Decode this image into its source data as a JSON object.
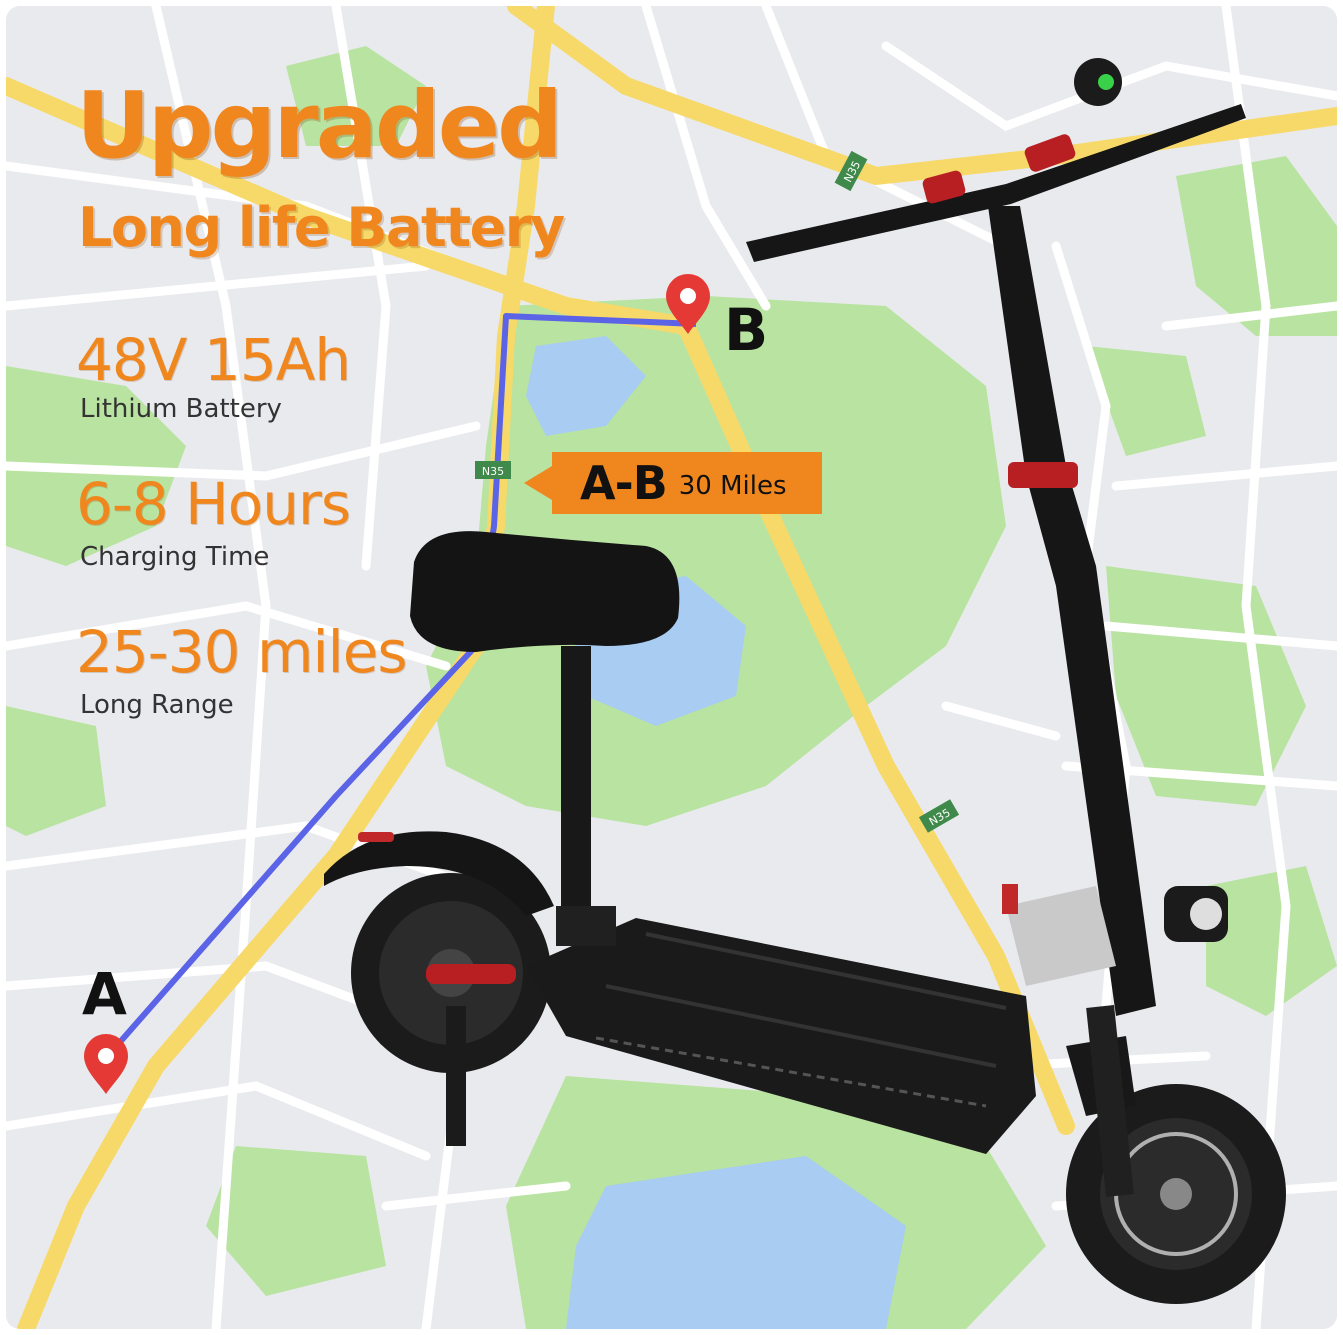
{
  "headline": "Upgraded",
  "subheadline": "Long life Battery",
  "specs": [
    {
      "value": "48V 15Ah",
      "label": "Lithium Battery"
    },
    {
      "value": "6-8 Hours",
      "label": "Charging Time"
    },
    {
      "value": "25-30 miles",
      "label": "Long Range"
    }
  ],
  "route": {
    "start_label": "A",
    "end_label": "B",
    "callout_route": "A-B",
    "callout_distance": "30 Miles"
  },
  "road_signs": [
    "N35",
    "N35",
    "N35"
  ],
  "colors": {
    "accent": "#f0871e",
    "map_background": "#e9eaee",
    "park": "#b9e3a0",
    "water": "#a8ccf2",
    "major_road": "#f7d96a",
    "route_line": "#5b63e6",
    "pin": "#e53935"
  },
  "icons": [
    "map-pin-icon",
    "map-pin-icon"
  ]
}
